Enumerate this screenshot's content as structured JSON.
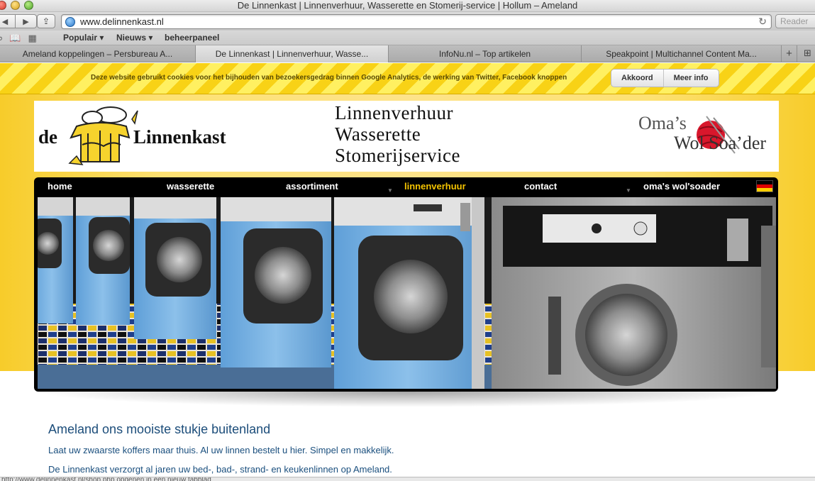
{
  "window": {
    "title": "De Linnenkast | Linnenverhuur, Wasserette en Stomerij-service | Hollum – Ameland"
  },
  "toolbar": {
    "url": "www.delinnenkast.nl",
    "reader_label": "Reader"
  },
  "bookmarks": {
    "items": [
      "Populair ▾",
      "Nieuws ▾",
      "beheerpaneel"
    ]
  },
  "tabs": [
    {
      "label": "Ameland koppelingen – Persbureau A..."
    },
    {
      "label": "De Linnenkast | Linnenverhuur, Wasse..."
    },
    {
      "label": "InfoNu.nl – Top artikelen"
    },
    {
      "label": "Speakpoint | Multichannel Content Ma..."
    }
  ],
  "cookie": {
    "text": "Deze website gebruikt cookies voor het bijhouden van bezoekersgedrag binnen Google Analytics, de werking van Twitter, Facebook knoppen",
    "accept_label": "Akkoord",
    "more_label": "Meer info"
  },
  "header": {
    "logo_prefix": "de",
    "logo_name": "Linnenkast",
    "tagline": [
      "Linnenverhuur",
      "Wasserette",
      "Stomerijservice"
    ],
    "oma_line1": "Oma’s",
    "oma_line2": "Wol Soa’der"
  },
  "menu": {
    "items": [
      "home",
      "wasserette",
      "assortiment",
      "linnenverhuur",
      "contact",
      "oma's wol'soader"
    ],
    "active_index": 3
  },
  "content": {
    "title": "Ameland ons mooiste stukje buitenland",
    "paragraphs": [
      "Laat uw zwaarste koffers maar thuis. Al uw linnen bestelt u hier. Simpel en makkelijk.",
      "De Linnenkast verzorgt al jaren uw bed-, bad-, strand- en keukenlinnen op Ameland."
    ]
  },
  "status": {
    "text": "http://www.delinnenkast.nl/shop.php opgenen in een nieuw tabblad"
  },
  "colors": {
    "accent": "#f5c400",
    "content_blue": "#1c4d7a",
    "page_yellow": "#fde173"
  }
}
